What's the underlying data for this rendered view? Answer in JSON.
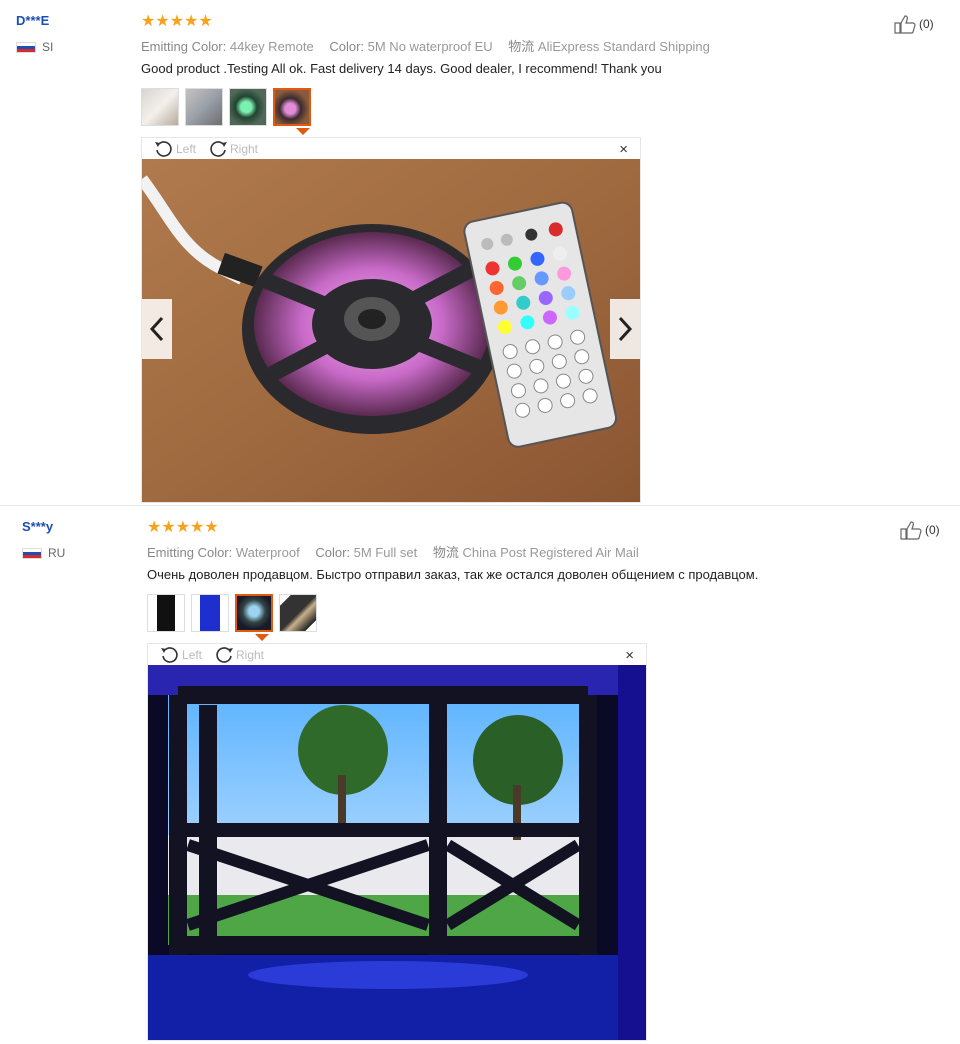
{
  "reviews": [
    {
      "user": "D***E",
      "country": "SI",
      "stars": "★★★★★",
      "attrs": {
        "emitting_label": "Emitting Color:",
        "emitting_value": "44key Remote",
        "color_label": "Color:",
        "color_value": "5M No waterproof EU",
        "shipping_label": "物流",
        "shipping_value": "AliExpress Standard Shipping"
      },
      "text": "Good product .Testing All ok. Fast delivery 14 days. Good dealer, I recommend! Thank you",
      "likes": "(0)",
      "viewer": {
        "left_label": "Left",
        "right_label": "Right",
        "close": "×"
      }
    },
    {
      "user": "S***y",
      "country": "RU",
      "stars": "★★★★★",
      "attrs": {
        "emitting_label": "Emitting Color:",
        "emitting_value": "Waterproof",
        "color_label": "Color:",
        "color_value": "5M Full set",
        "shipping_label": "物流",
        "shipping_value": "China Post Registered Air Mail"
      },
      "text": "Очень доволен продавцом. Быстро отправил заказ, так же остался доволен общением с продавцом.",
      "likes": "(0)",
      "viewer": {
        "left_label": "Left",
        "right_label": "Right",
        "close": "×"
      }
    }
  ],
  "colors": {
    "user": "#1a4fb4",
    "stars": "#f7a21b",
    "active_thumb": "#e15a12"
  },
  "icons": [
    "thumbs-up-icon",
    "rotate-left-icon",
    "rotate-right-icon",
    "close-icon",
    "chevron-left-icon",
    "chevron-right-icon"
  ]
}
